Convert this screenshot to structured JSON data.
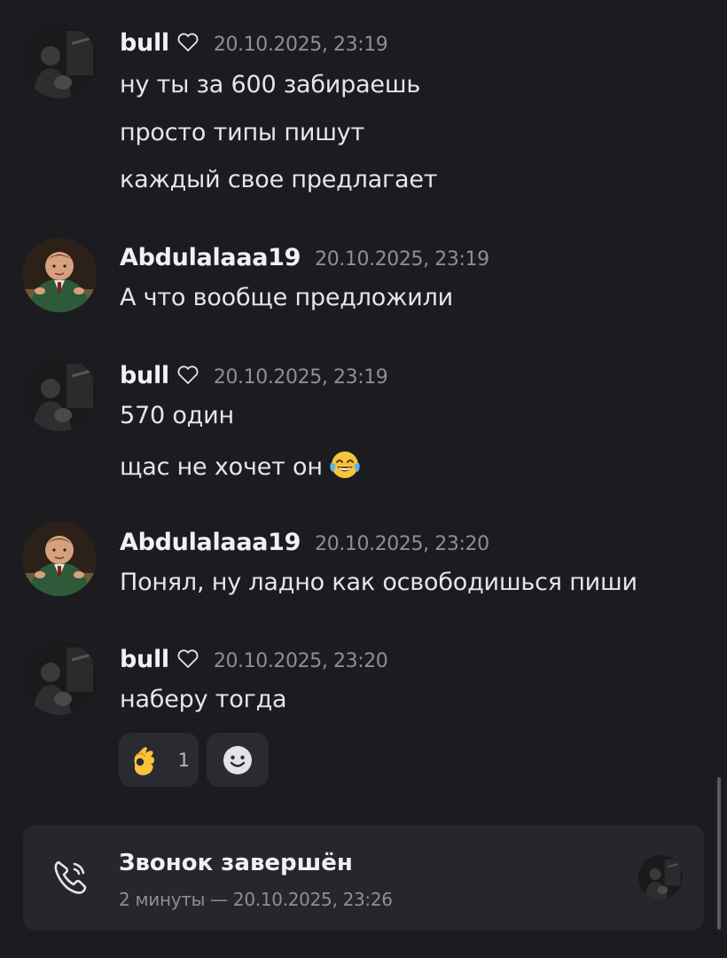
{
  "messages": [
    {
      "author": "bull",
      "timestamp": "20.10.2025, 23:19",
      "lines": [
        "ну ты за 600 забираешь",
        "просто типы пишут",
        "каждый свое предлагает"
      ]
    },
    {
      "author": "Abdulalaaa19",
      "timestamp": "20.10.2025, 23:19",
      "lines": [
        "А что вообще предложили"
      ]
    },
    {
      "author": "bull",
      "timestamp": "20.10.2025, 23:19",
      "lines": [
        "570 один",
        "щас не хочет он"
      ]
    },
    {
      "author": "Abdulalaaa19",
      "timestamp": "20.10.2025, 23:20",
      "lines": [
        "Понял, ну ладно как освободишься пиши"
      ]
    },
    {
      "author": "bull",
      "timestamp": "20.10.2025, 23:20",
      "lines": [
        "наберу тогда"
      ]
    }
  ],
  "reactions": {
    "ok_hand_count": "1",
    "ok_hand_icon": "ok-hand-emoji",
    "add_reaction_icon": "smile-icon"
  },
  "call": {
    "title": "Звонок завершён",
    "subtitle": "2 минуты — 20.10.2025, 23:26",
    "icon": "phone-call-icon"
  },
  "colors": {
    "background": "#1c1c20",
    "card": "#26272d",
    "muted_text": "#8d8e96"
  }
}
